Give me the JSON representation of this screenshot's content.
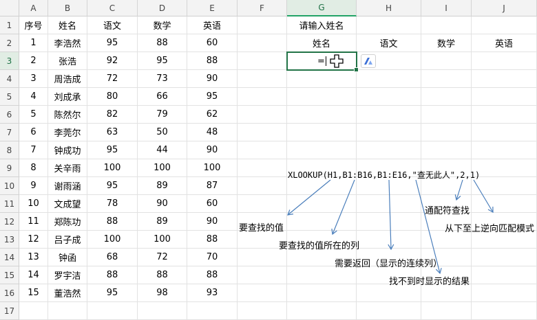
{
  "columns": [
    "A",
    "B",
    "C",
    "D",
    "E",
    "F",
    "G",
    "H",
    "I",
    "J"
  ],
  "rows": [
    "1",
    "2",
    "3",
    "4",
    "5",
    "6",
    "7",
    "8",
    "9",
    "10",
    "11",
    "12",
    "13",
    "14",
    "15",
    "16",
    "17"
  ],
  "table_headers": [
    "序号",
    "姓名",
    "语文",
    "数学",
    "英语"
  ],
  "table_rows": [
    [
      "1",
      "李浩然",
      "95",
      "88",
      "60"
    ],
    [
      "2",
      "张浩",
      "92",
      "95",
      "88"
    ],
    [
      "3",
      "周浩成",
      "72",
      "73",
      "90"
    ],
    [
      "4",
      "刘成承",
      "80",
      "66",
      "95"
    ],
    [
      "5",
      "陈然尔",
      "82",
      "79",
      "62"
    ],
    [
      "6",
      "李莞尔",
      "63",
      "50",
      "48"
    ],
    [
      "7",
      "钟成功",
      "95",
      "44",
      "90"
    ],
    [
      "8",
      "关辛雨",
      "100",
      "100",
      "100"
    ],
    [
      "9",
      "谢雨涵",
      "95",
      "89",
      "87"
    ],
    [
      "10",
      "文成望",
      "78",
      "90",
      "60"
    ],
    [
      "11",
      "郑陈功",
      "88",
      "89",
      "90"
    ],
    [
      "12",
      "吕子成",
      "100",
      "100",
      "88"
    ],
    [
      "13",
      "钟函",
      "68",
      "72",
      "70"
    ],
    [
      "14",
      "罗宇洁",
      "88",
      "88",
      "88"
    ],
    [
      "15",
      "董浩然",
      "95",
      "98",
      "93"
    ]
  ],
  "lookup": {
    "prompt": "请输入姓名",
    "headers": [
      "姓名",
      "语文",
      "数学",
      "英语"
    ],
    "active_value": "="
  },
  "annotations": {
    "formula": "XLOOKUP(H1,B1:B16,B1:E16,\"查无此人\",2,1)",
    "notes": [
      "要查找的值",
      "要查找的值所在的列",
      "需要返回（显示的连续列）",
      "找不到时显示的结果",
      "通配符查找",
      "从下至上逆向匹配模式"
    ]
  },
  "icons": {
    "ai_button": "ai-assistant-icon",
    "cursor": "cross-move-cursor-icon"
  },
  "colors": {
    "accent": "#217346",
    "arrow": "#4a7ebb"
  }
}
